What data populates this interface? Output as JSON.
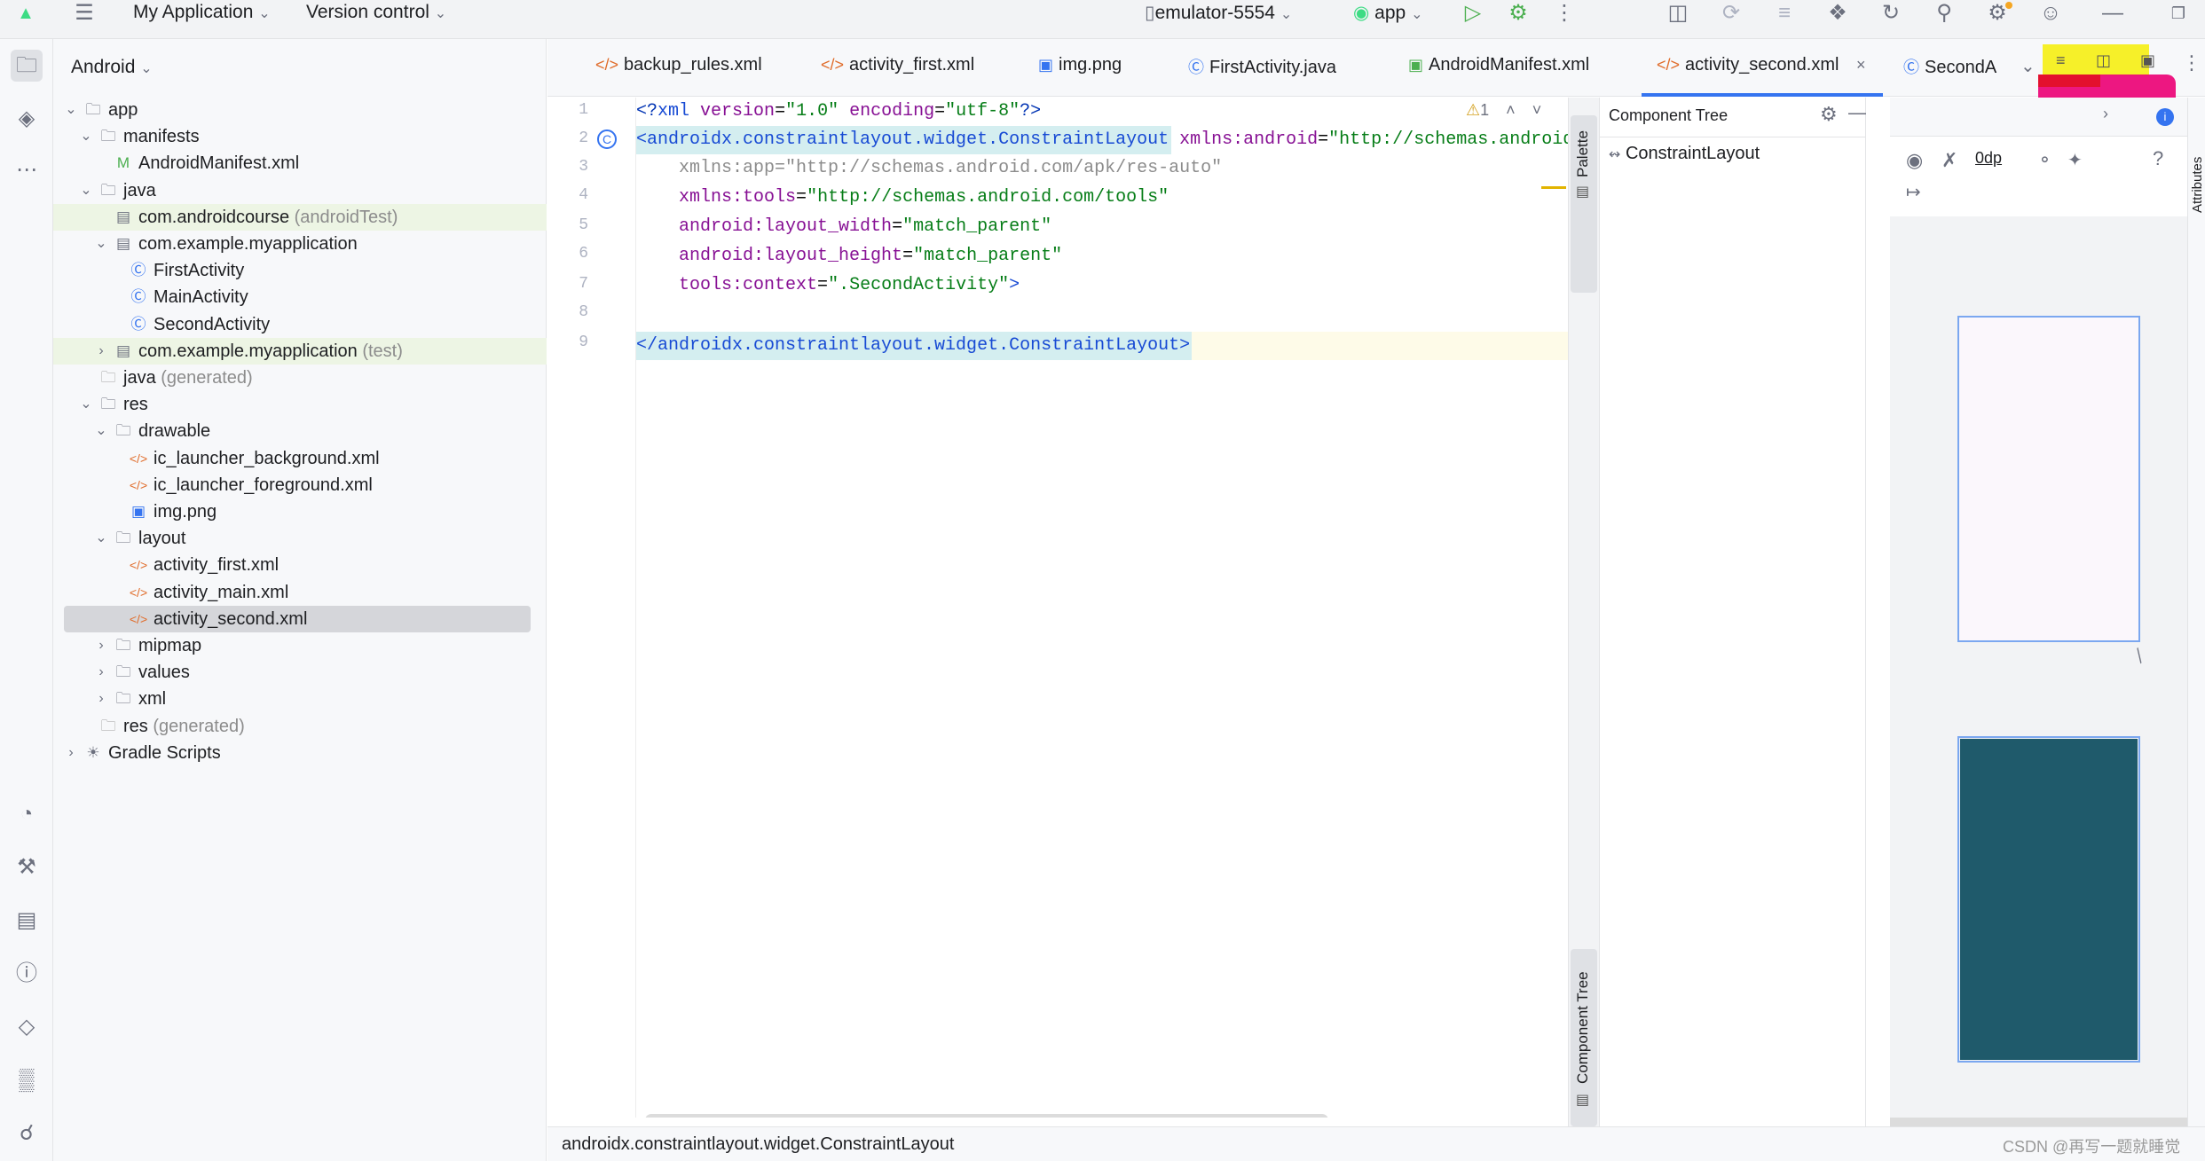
{
  "titlebar": {
    "project": "My Application",
    "vcs": "Version control",
    "device": "emulator-5554",
    "run_config": "app"
  },
  "project_panel": {
    "view": "Android",
    "tree": [
      {
        "label": "app",
        "depth": 0,
        "expanded": true,
        "icon": "folder-module-icon"
      },
      {
        "label": "manifests",
        "depth": 1,
        "expanded": true,
        "icon": "folder-icon"
      },
      {
        "label": "AndroidManifest.xml",
        "depth": 2,
        "icon": "manifest-icon"
      },
      {
        "label": "java",
        "depth": 1,
        "expanded": true,
        "icon": "folder-icon"
      },
      {
        "label": "com.androidcourse",
        "suffix": "(androidTest)",
        "depth": 2,
        "icon": "package-icon",
        "highlight": true
      },
      {
        "label": "com.example.myapplication",
        "depth": 2,
        "expanded": true,
        "icon": "package-icon"
      },
      {
        "label": "FirstActivity",
        "depth": 3,
        "icon": "class-icon"
      },
      {
        "label": "MainActivity",
        "depth": 3,
        "icon": "class-icon"
      },
      {
        "label": "SecondActivity",
        "depth": 3,
        "icon": "class-icon"
      },
      {
        "label": "com.example.myapplication",
        "suffix": "(test)",
        "depth": 2,
        "collapsed": true,
        "icon": "package-icon",
        "highlight": true
      },
      {
        "label": "java",
        "suffix": "(generated)",
        "depth": 1,
        "icon": "folder-generated-icon"
      },
      {
        "label": "res",
        "depth": 1,
        "expanded": true,
        "icon": "folder-res-icon"
      },
      {
        "label": "drawable",
        "depth": 2,
        "expanded": true,
        "icon": "folder-icon"
      },
      {
        "label": "ic_launcher_background.xml",
        "depth": 3,
        "icon": "xml-icon"
      },
      {
        "label": "ic_launcher_foreground.xml",
        "depth": 3,
        "icon": "xml-icon"
      },
      {
        "label": "img.png",
        "depth": 3,
        "icon": "image-icon"
      },
      {
        "label": "layout",
        "depth": 2,
        "expanded": true,
        "icon": "folder-icon"
      },
      {
        "label": "activity_first.xml",
        "depth": 3,
        "icon": "xml-icon"
      },
      {
        "label": "activity_main.xml",
        "depth": 3,
        "icon": "xml-icon"
      },
      {
        "label": "activity_second.xml",
        "depth": 3,
        "icon": "xml-icon",
        "selected": true
      },
      {
        "label": "mipmap",
        "depth": 2,
        "collapsed": true,
        "icon": "folder-icon"
      },
      {
        "label": "values",
        "depth": 2,
        "collapsed": true,
        "icon": "folder-icon"
      },
      {
        "label": "xml",
        "depth": 2,
        "collapsed": true,
        "icon": "folder-icon"
      },
      {
        "label": "res",
        "suffix": "(generated)",
        "depth": 1,
        "icon": "folder-generated-icon"
      },
      {
        "label": "Gradle Scripts",
        "depth": 0,
        "collapsed": true,
        "icon": "gradle-icon"
      }
    ]
  },
  "tabs": [
    {
      "label": "backup_rules.xml",
      "icon": "xml-icon"
    },
    {
      "label": "activity_first.xml",
      "icon": "xml-icon"
    },
    {
      "label": "img.png",
      "icon": "image-icon"
    },
    {
      "label": "FirstActivity.java",
      "icon": "class-icon"
    },
    {
      "label": "AndroidManifest.xml",
      "icon": "manifest-icon"
    },
    {
      "label": "activity_second.xml",
      "icon": "xml-icon",
      "active": true
    },
    {
      "label": "SecondA",
      "icon": "class-icon"
    }
  ],
  "editor": {
    "line_numbers": [
      "1",
      "2",
      "3",
      "4",
      "5",
      "6",
      "7",
      "8",
      "9"
    ],
    "warning_count": "1",
    "lines": [
      "<?xml version=\"1.0\" encoding=\"utf-8\"?>",
      "<androidx.constraintlayout.widget.ConstraintLayout xmlns:android=\"http://schemas.android",
      "    xmlns:app=\"http://schemas.android.com/apk/res-auto\"",
      "    xmlns:tools=\"http://schemas.android.com/tools\"",
      "    android:layout_width=\"match_parent\"",
      "    android:layout_height=\"match_parent\"",
      "    tools:context=\".SecondActivity\">",
      "",
      "</androidx.constraintlayout.widget.ConstraintLayout>"
    ]
  },
  "palette_label": "Palette",
  "component_tree": {
    "title": "Component Tree",
    "root": "ConstraintLayout",
    "side_label": "Component Tree"
  },
  "design": {
    "margin_value": "0dp",
    "help": "?",
    "blueprint_color": "#1f5a6b"
  },
  "right_strip_label": "Attributes",
  "status_bar": {
    "path": "androidx.constraintlayout.widget.ConstraintLayout",
    "watermark": "CSDN @再写一题就睡觉"
  }
}
